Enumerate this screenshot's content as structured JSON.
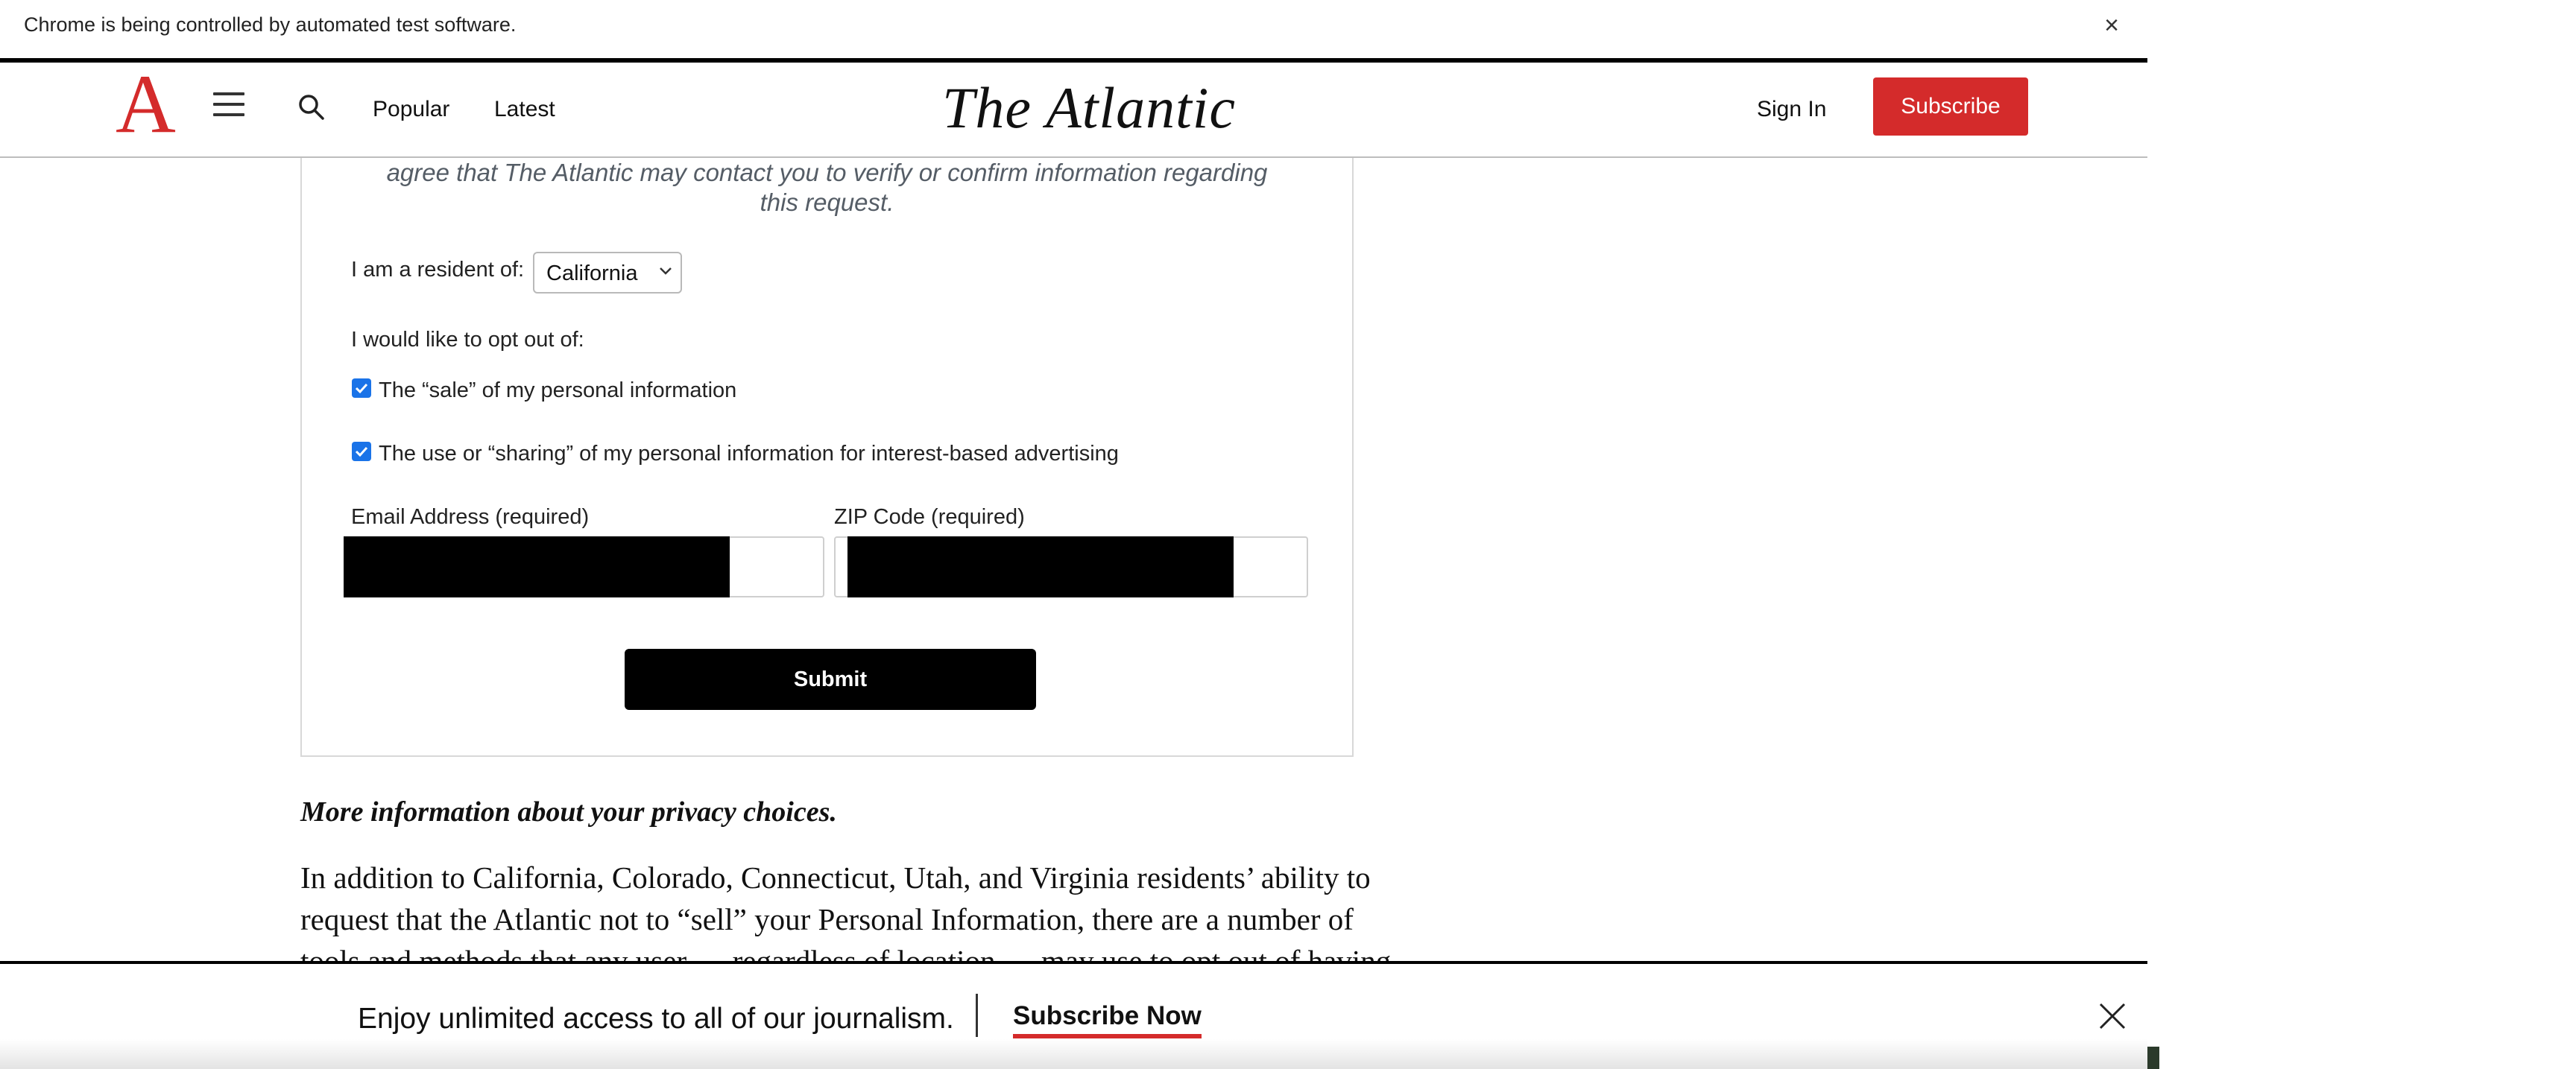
{
  "infobar": {
    "message": "Chrome is being controlled by automated test software.",
    "close_glyph": "×"
  },
  "header": {
    "logo_letter": "A",
    "brand": "The Atlantic",
    "nav": [
      "Popular",
      "Latest"
    ],
    "sign_in": "Sign In",
    "subscribe": "Subscribe",
    "accent_color": "#d42b2b",
    "icons": {
      "menu": "hamburger-menu-icon",
      "search": "search-icon"
    }
  },
  "form": {
    "note_line1": "agree that The Atlantic may contact you to verify or confirm information regarding",
    "note_line2": "this request.",
    "resident_label": "I am a resident of:",
    "resident_value": "California",
    "opt_out_label": "I would like to opt out of:",
    "options": [
      {
        "label": "The “sale” of my personal information",
        "checked": true
      },
      {
        "label": "The use or “sharing” of my personal information for interest-based advertising",
        "checked": true
      }
    ],
    "email_label": "Email Address (required)",
    "zip_label": "ZIP Code (required)",
    "submit": "Submit",
    "checkbox_color": "#1a73e8"
  },
  "article": {
    "heading": "More information about your privacy choices.",
    "paragraph_lines": [
      "In addition to California, Colorado, Connecticut, Utah, and Virginia residents’ ability to",
      "request that the Atlantic not to “sell” your Personal Information, there are a number of",
      "tools and methods that any user — regardless of location — may use to opt out of having"
    ]
  },
  "banner": {
    "pitch": "Enjoy unlimited access to all of our journalism.",
    "cta": "Subscribe Now",
    "close_icon": "close-icon"
  }
}
